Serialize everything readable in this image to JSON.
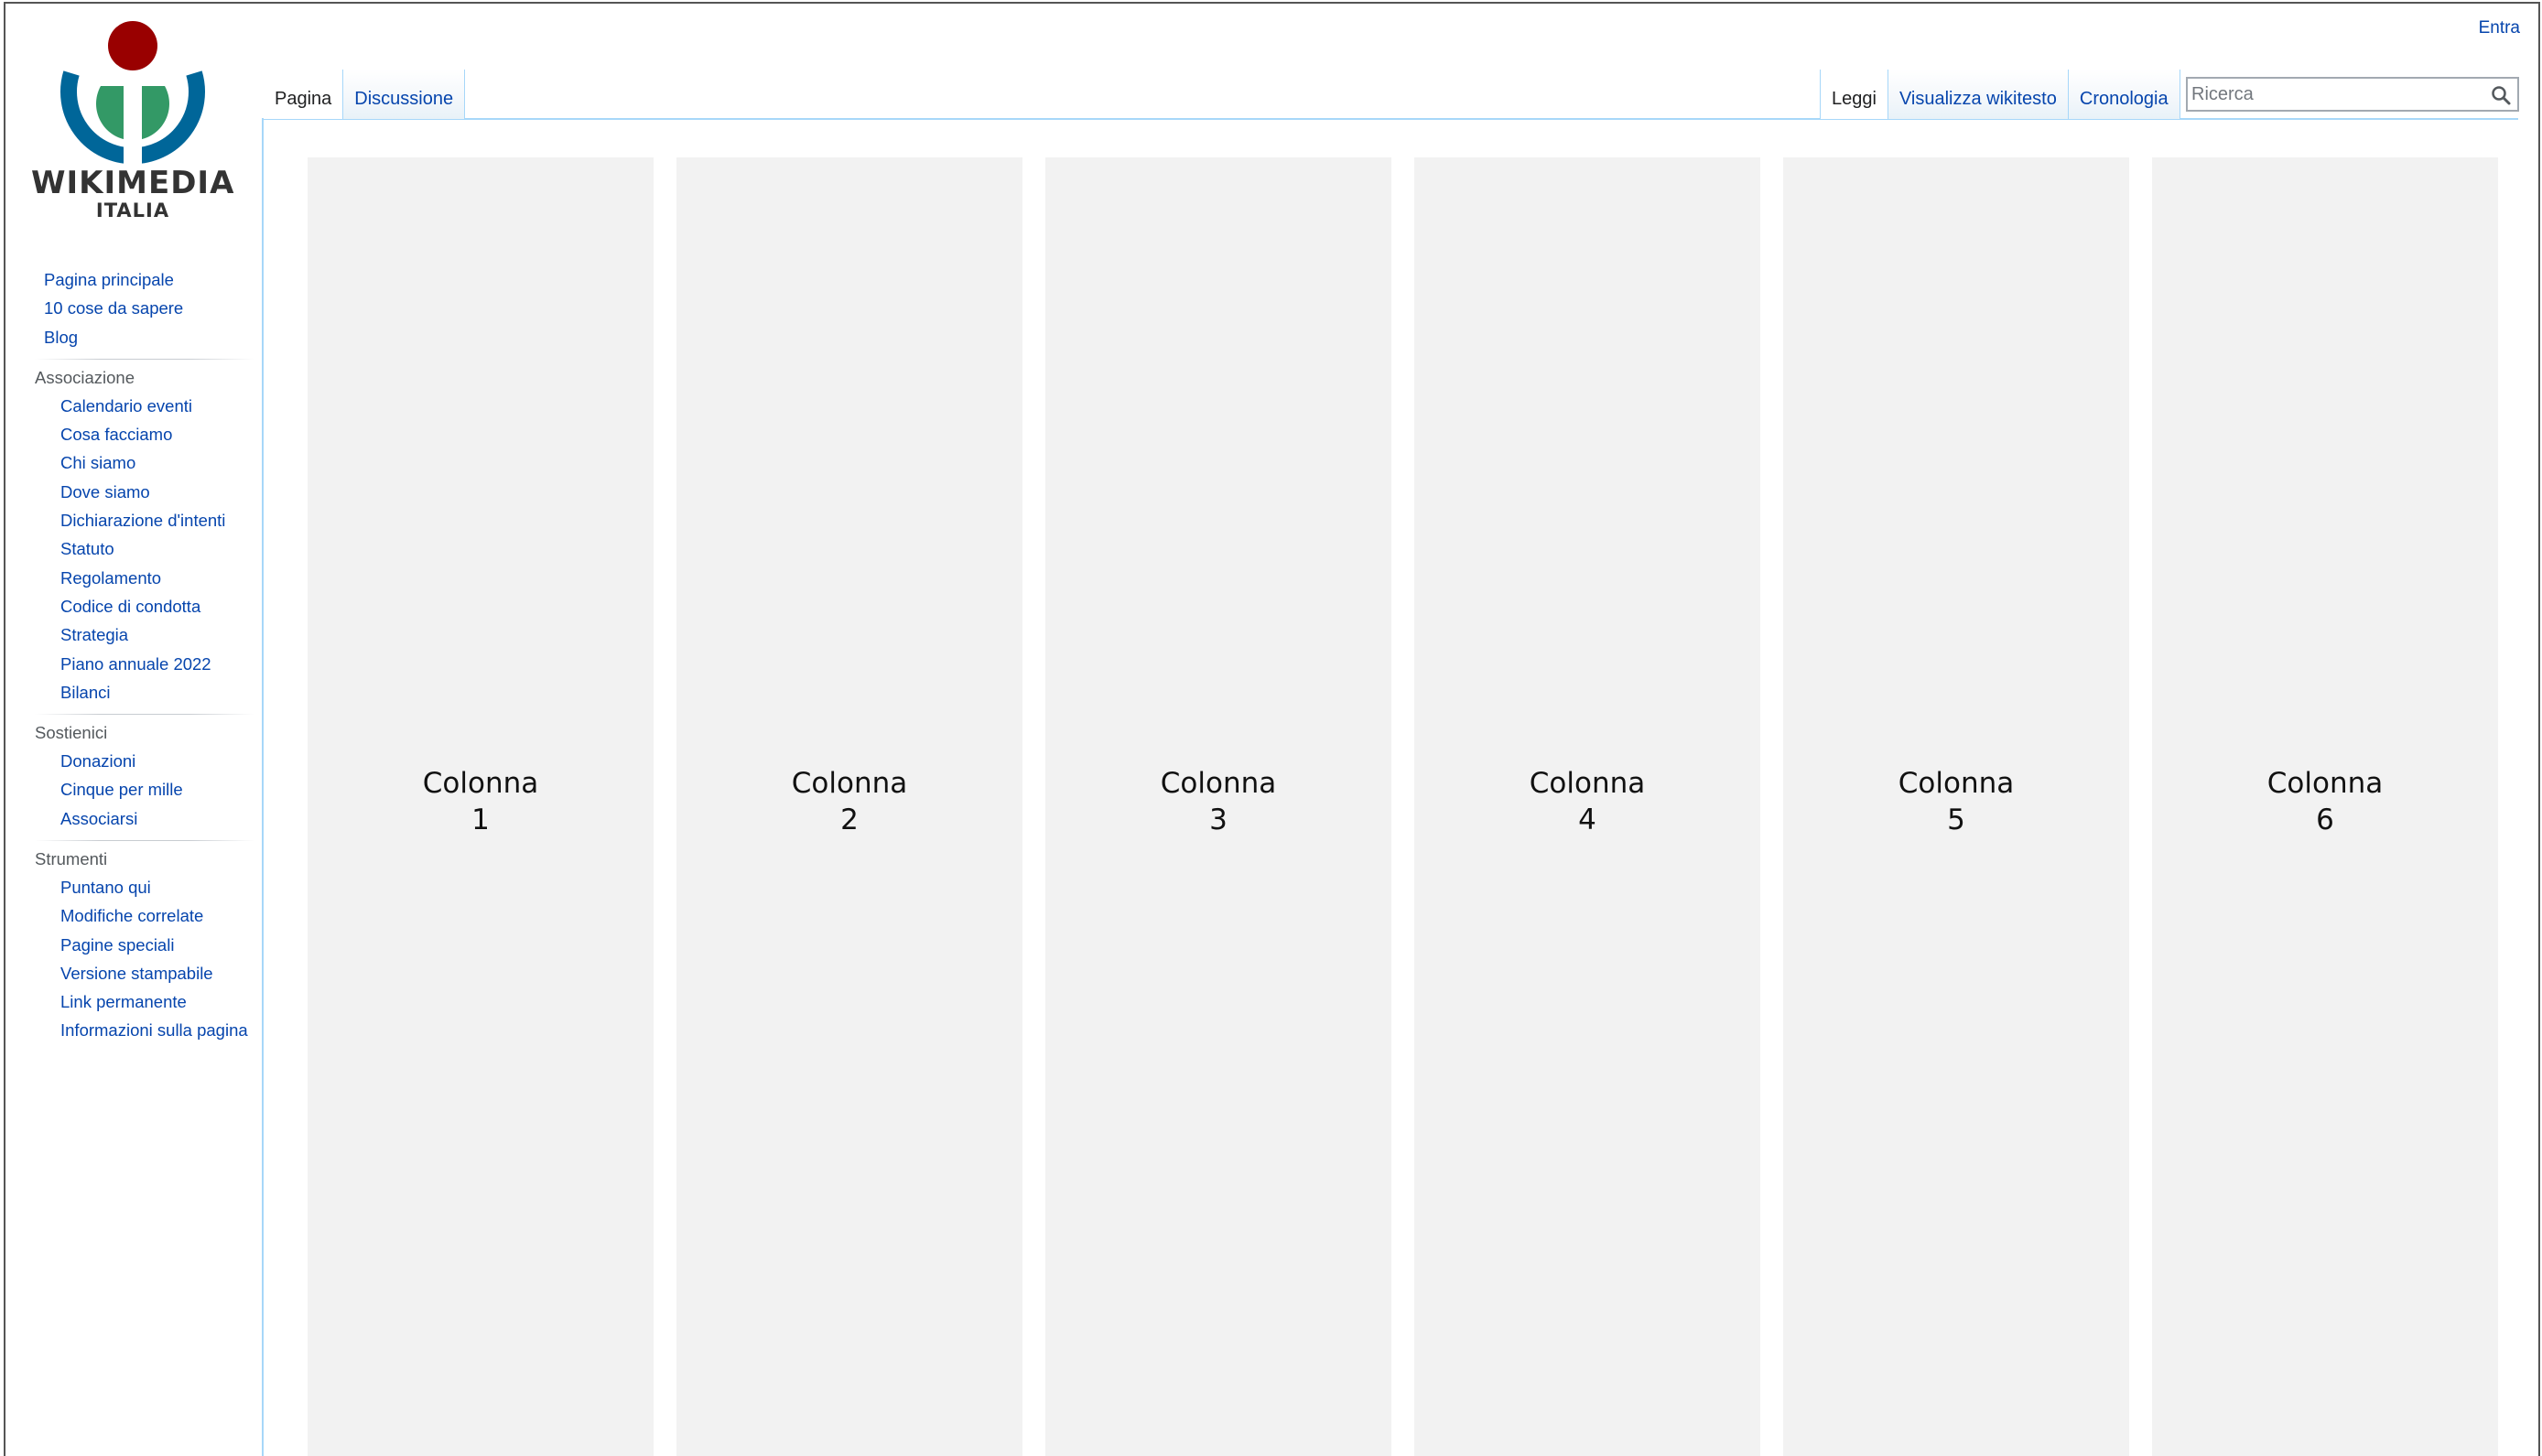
{
  "header": {
    "login_label": "Entra",
    "search": {
      "placeholder": "Ricerca"
    }
  },
  "logo": {
    "wordmark": "WIKIMEDIA",
    "subtitle": "ITALIA",
    "colors": {
      "red": "#990000",
      "green": "#339966",
      "blue": "#006699"
    }
  },
  "tabs": {
    "left": [
      {
        "label": "Pagina",
        "selected": true
      },
      {
        "label": "Discussione",
        "selected": false
      }
    ],
    "right": [
      {
        "label": "Leggi",
        "selected": true
      },
      {
        "label": "Visualizza wikitesto",
        "selected": false
      },
      {
        "label": "Cronologia",
        "selected": false
      }
    ]
  },
  "sidebar": {
    "main_links": [
      "Pagina principale",
      "10 cose da sapere",
      "Blog"
    ],
    "sections": [
      {
        "heading": "Associazione",
        "items": [
          "Calendario eventi",
          "Cosa facciamo",
          "Chi siamo",
          "Dove siamo",
          "Dichiarazione d'intenti",
          "Statuto",
          "Regolamento",
          "Codice di condotta",
          "Strategia",
          "Piano annuale 2022",
          "Bilanci"
        ]
      },
      {
        "heading": "Sostienici",
        "items": [
          "Donazioni",
          "Cinque per mille",
          "Associarsi"
        ]
      },
      {
        "heading": "Strumenti",
        "items": [
          "Puntano qui",
          "Modifiche correlate",
          "Pagine speciali",
          "Versione stampabile",
          "Link permanente",
          "Informazioni sulla pagina"
        ]
      }
    ]
  },
  "columns": [
    {
      "word": "Colonna",
      "number": "1"
    },
    {
      "word": "Colonna",
      "number": "2"
    },
    {
      "word": "Colonna",
      "number": "3"
    },
    {
      "word": "Colonna",
      "number": "4"
    },
    {
      "word": "Colonna",
      "number": "5"
    },
    {
      "word": "Colonna",
      "number": "6"
    }
  ],
  "colors": {
    "link": "#0645ad",
    "tab_border": "#a7d7f9",
    "column_bg": "#f2f2f2"
  }
}
